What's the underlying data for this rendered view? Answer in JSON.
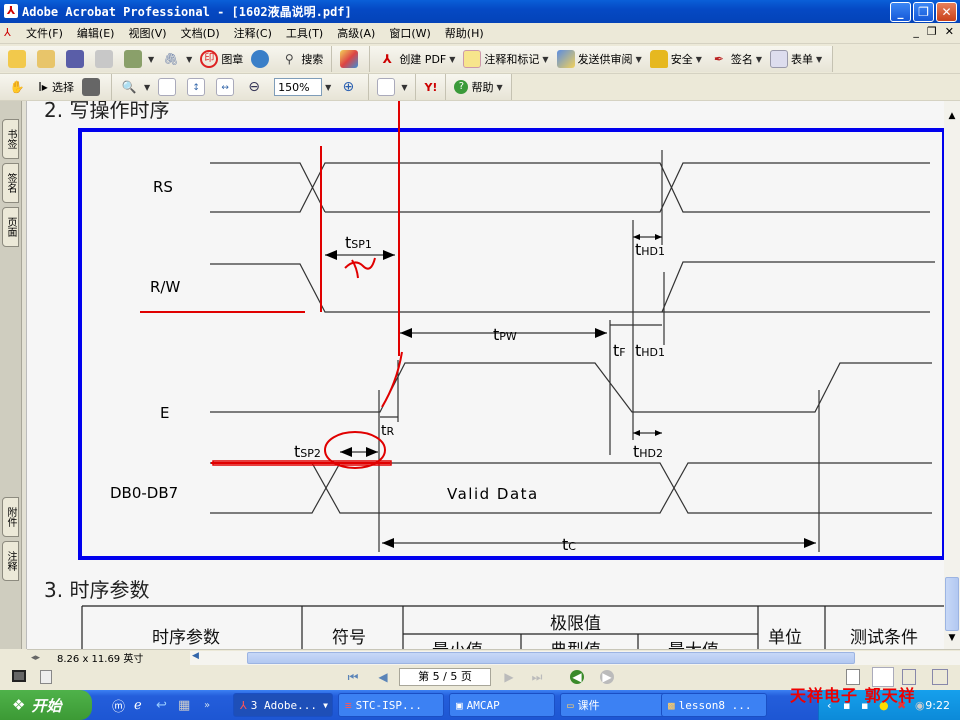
{
  "window": {
    "title": "Adobe Acrobat Professional - [1602液晶说明.pdf]",
    "minimize": "_",
    "restore": "❐",
    "close": "✕"
  },
  "menu": {
    "items": [
      "文件(F)",
      "编辑(E)",
      "视图(V)",
      "文档(D)",
      "注释(C)",
      "工具(T)",
      "高级(A)",
      "窗口(W)",
      "帮助(H)"
    ],
    "mdi": [
      "_",
      "❐",
      "✕"
    ]
  },
  "toolbar1": {
    "stamp": "图章",
    "search": "搜索",
    "create_pdf": "创建 PDF",
    "comment": "注释和标记",
    "review": "发送供审阅",
    "secure": "安全",
    "sign": "签名",
    "forms": "表单"
  },
  "toolbar2": {
    "select": "选择",
    "zoom_value": "150%",
    "help": "帮助",
    "yahoo": "Y!"
  },
  "side_tabs": {
    "top": [
      "书签",
      "签名",
      "页面"
    ],
    "bottom": [
      "附件",
      "注释"
    ]
  },
  "document": {
    "section2_title": "2. 写操作时序",
    "section3_title": "3. 时序参数",
    "signals": [
      "RS",
      "R/W",
      "E",
      "DB0-DB7"
    ],
    "valid_data": "Valid Data",
    "timing_labels": {
      "tsp1": "SP1",
      "tpw": "PW",
      "tf": "F",
      "thd1": "HD1",
      "thd1b": "HD1",
      "tr": "R",
      "tsp2": "SP2",
      "thd2": "HD2",
      "tc": "C"
    },
    "table": {
      "headers": [
        "时序参数",
        "符号",
        "极限值",
        "单位",
        "测试条件"
      ],
      "subheaders": [
        "最小值",
        "典型值",
        "最大值"
      ]
    },
    "colors": {
      "frame": "#0000ee",
      "annotation": "#e00000"
    }
  },
  "status": {
    "page_size": "8.26 x 11.69 英寸",
    "page_indicator": "第 5 / 5 页"
  },
  "taskbar": {
    "start": "开始",
    "tasks": [
      "3 Adobe...",
      "STC-ISP...",
      "AMCAP",
      "课件",
      "lesson8 ..."
    ],
    "clock": "9:22",
    "watermark": "天祥电子  郭天祥"
  }
}
